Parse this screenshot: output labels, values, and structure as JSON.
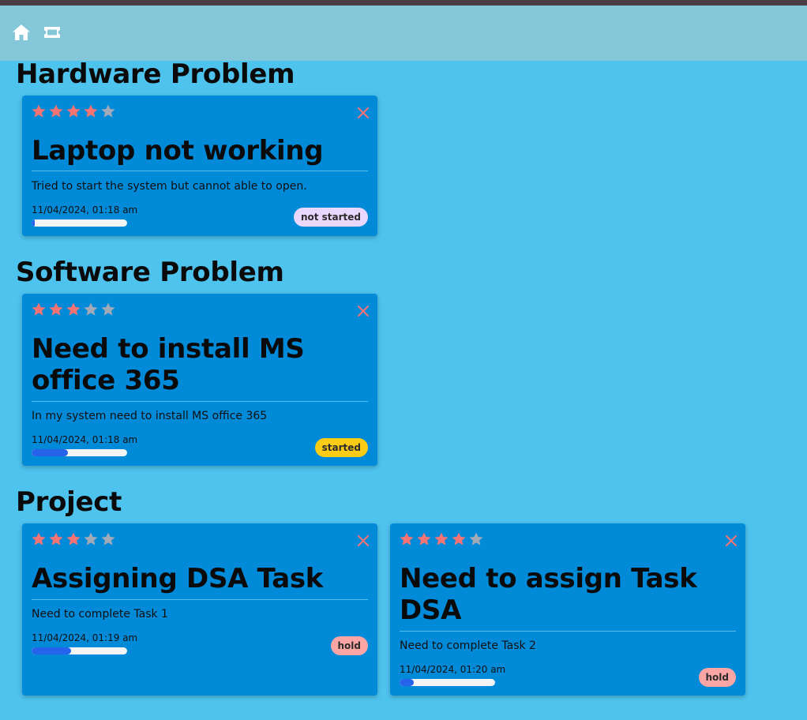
{
  "colors": {
    "star_on": "#f77374",
    "star_off": "#a3aab7",
    "close": "#f77374",
    "progress": "#2563eb",
    "status_not_started": "#e9d7fe",
    "status_started": "#facc15",
    "status_hold": "#fca5a5"
  },
  "navbar": {
    "icons": [
      "home-icon",
      "ticket-icon"
    ]
  },
  "sections": [
    {
      "title": "Hardware Problem",
      "cards": [
        {
          "rating": 4,
          "max_rating": 5,
          "title": "Laptop not working",
          "description": "Tried to start the system but cannot able to open.",
          "timestamp": "11/04/2024, 01:18 am",
          "progress": 0.03,
          "status": "not started"
        }
      ]
    },
    {
      "title": "Software Problem",
      "cards": [
        {
          "rating": 3,
          "max_rating": 5,
          "title": "Need to install MS office 365",
          "description": "In my system need to install MS office 365",
          "timestamp": "11/04/2024, 01:18 am",
          "progress": 0.38,
          "status": "started"
        }
      ]
    },
    {
      "title": "Project",
      "cards": [
        {
          "rating": 3,
          "max_rating": 5,
          "title": "Assigning DSA Task",
          "description": "Need to complete Task 1",
          "timestamp": "11/04/2024, 01:19 am",
          "progress": 0.41,
          "status": "hold"
        },
        {
          "rating": 4,
          "max_rating": 5,
          "title": "Need to assign Task DSA",
          "description": "Need to complete Task 2",
          "timestamp": "11/04/2024, 01:20 am",
          "progress": 0.15,
          "status": "hold"
        }
      ]
    }
  ]
}
